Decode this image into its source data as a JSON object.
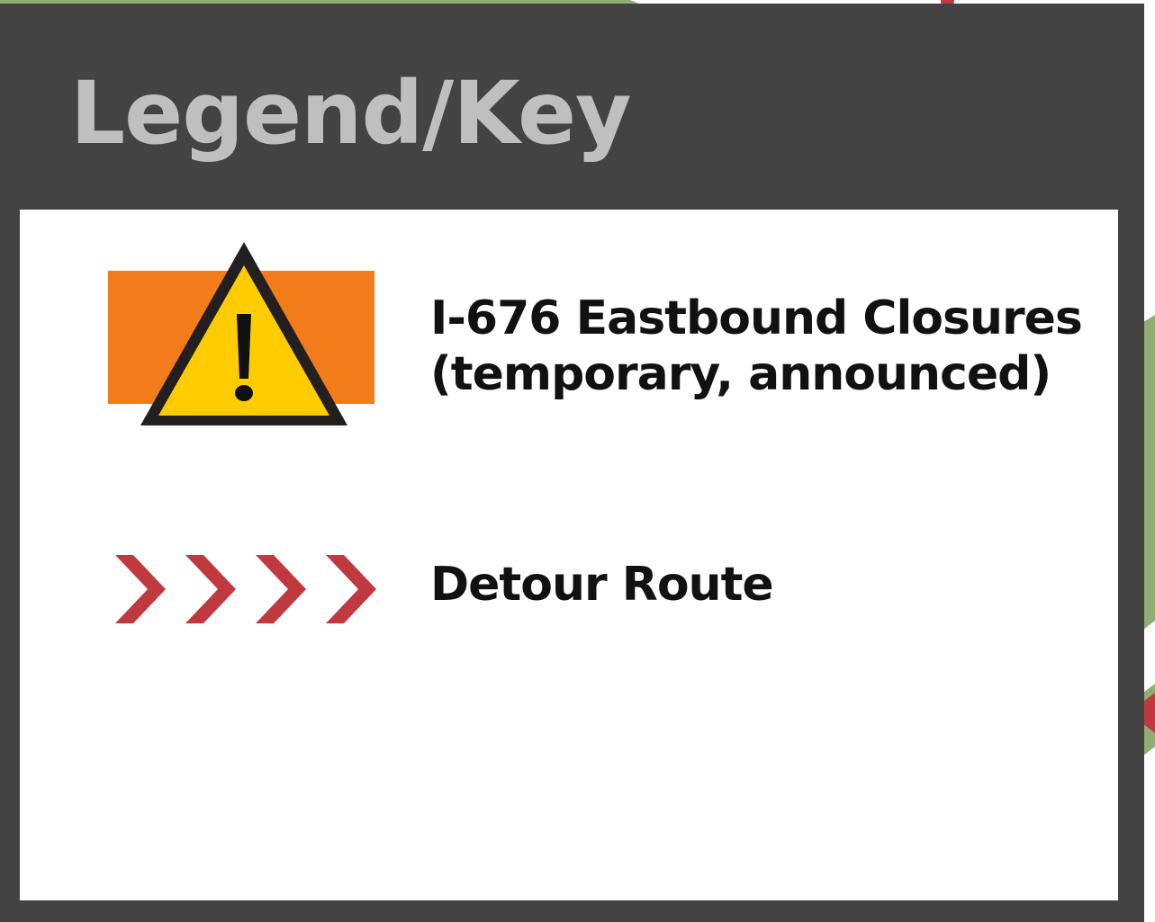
{
  "legend": {
    "title": "Legend/Key",
    "items": [
      {
        "icon": "warning-triangle-icon",
        "label_line1": "I-676 Eastbound Closures",
        "label_line2": "(temporary, announced)"
      },
      {
        "icon": "chevron-right-icon",
        "label": "Detour Route"
      }
    ]
  },
  "colors": {
    "panel_background": "#434343",
    "title_text": "#bfbfbf",
    "body_background": "#ffffff",
    "closure_orange": "#f17c19",
    "warning_yellow": "#ffcc00",
    "detour_red": "#c0393e",
    "map_green": "#8fae72"
  }
}
